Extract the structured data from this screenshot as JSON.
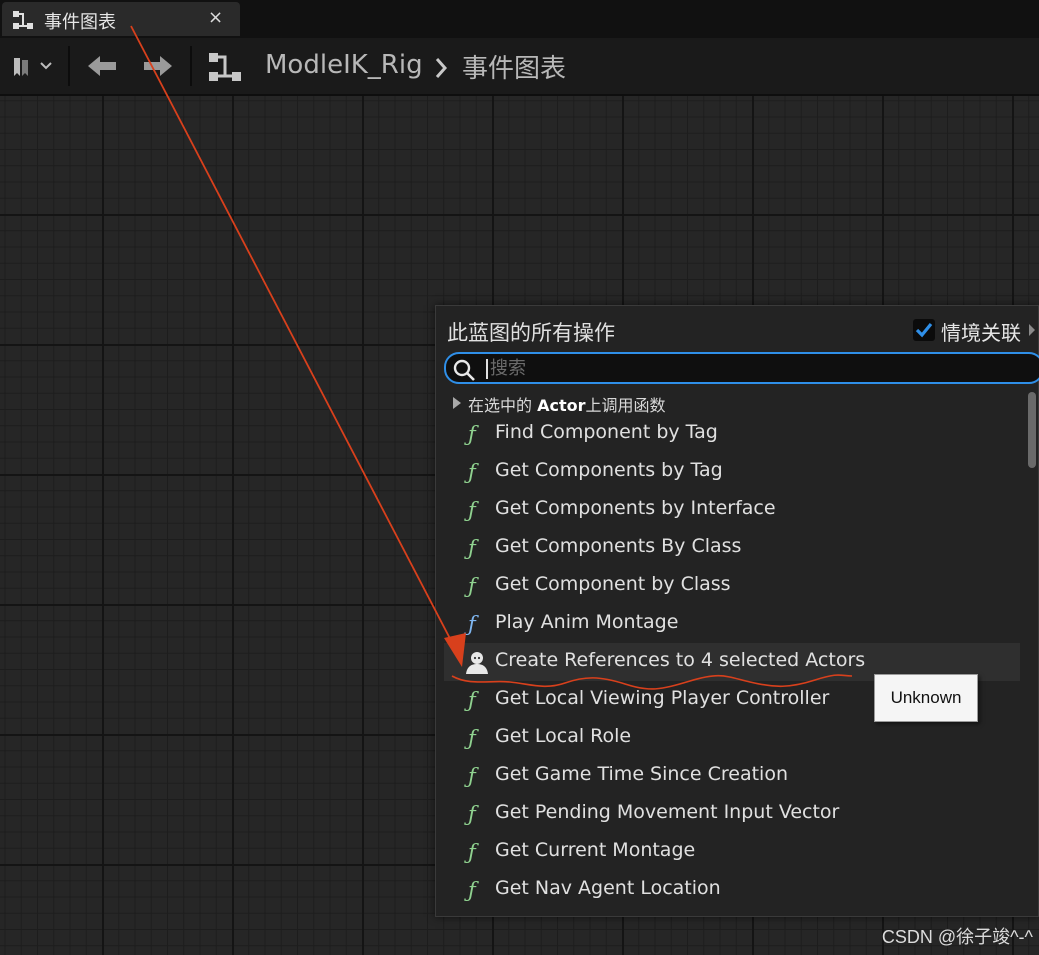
{
  "tab": {
    "title": "事件图表",
    "close": "×"
  },
  "toolbar": {
    "breadcrumb": [
      "ModleIK_Rig",
      "事件图表"
    ]
  },
  "action_menu": {
    "title": "此蓝图的所有操作",
    "context_sensitive": {
      "label": "情境关联",
      "checked": true
    },
    "search": {
      "placeholder": "搜索",
      "value": ""
    },
    "category": {
      "prefix": "在选中的 ",
      "bold": "Actor",
      "suffix": "上调用函数"
    },
    "items": [
      {
        "label": "Find Component by Tag",
        "icon": "function-icon"
      },
      {
        "label": "Get Components by Tag",
        "icon": "function-icon"
      },
      {
        "label": "Get Components by Interface",
        "icon": "function-icon"
      },
      {
        "label": "Get Components By Class",
        "icon": "function-icon"
      },
      {
        "label": "Get Component by Class",
        "icon": "function-icon"
      },
      {
        "label": "Play Anim Montage",
        "icon": "function-icon-blue"
      },
      {
        "label": "Create References to 4 selected Actors",
        "icon": "actor-icon"
      },
      {
        "label": "Get Local Viewing Player Controller",
        "icon": "function-icon"
      },
      {
        "label": "Get Local Role",
        "icon": "function-icon"
      },
      {
        "label": "Get Game Time Since Creation",
        "icon": "function-icon"
      },
      {
        "label": "Get Pending Movement Input Vector",
        "icon": "function-icon"
      },
      {
        "label": "Get Current Montage",
        "icon": "function-icon"
      },
      {
        "label": "Get Nav Agent Location",
        "icon": "function-icon"
      }
    ]
  },
  "tooltip": {
    "text": "Unknown"
  },
  "watermark": "CSDN @徐子竣^-^",
  "colors": {
    "accent": "#2f8fe8",
    "annotation": "#d8401c",
    "function_green": "#8fd18f"
  }
}
